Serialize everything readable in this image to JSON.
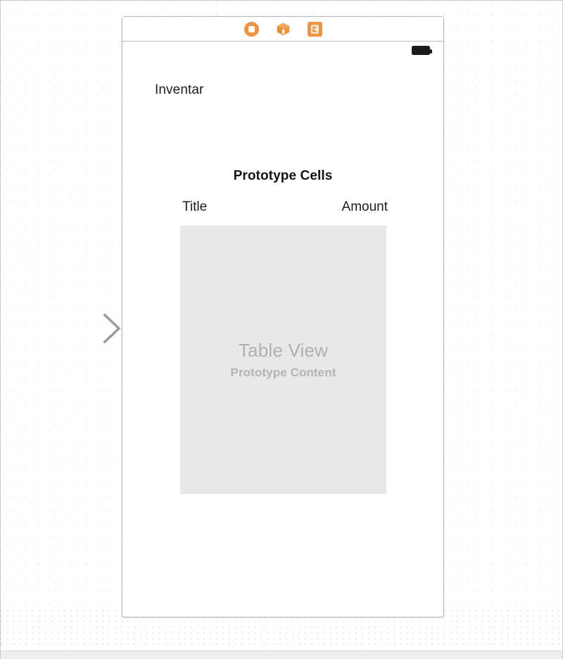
{
  "canvas": {
    "background_color": "#ffffff",
    "border_color": "#c9c9c9"
  },
  "entry_arrow": {
    "name": "initial-view-controller-arrow",
    "direction": "right",
    "color_start": "#ffffff",
    "color_end": "#9a9a9a"
  },
  "scene": {
    "accent_color": "#f0933f",
    "dock": {
      "icons": [
        {
          "id": "view-controller-icon",
          "label": "View Controller",
          "glyph": "rounded-square-in-circle"
        },
        {
          "id": "exit-cube-icon",
          "label": "Unwind Segue Cube",
          "glyph": "3d-cube"
        },
        {
          "id": "first-responder-icon",
          "label": "First Responder",
          "glyph": "exit-door"
        }
      ]
    },
    "status_bar": {
      "battery_icon": "battery-full-icon",
      "battery_color": "#1b1b1b"
    },
    "nav_title": "Inventar",
    "section_heading": "Prototype Cells",
    "columns": [
      {
        "label": "Title"
      },
      {
        "label": "Amount"
      }
    ],
    "table_view": {
      "title": "Table View",
      "subtitle": "Prototype Content",
      "fill_color": "#e8e8e8",
      "text_color": "#b0b0b0"
    }
  }
}
